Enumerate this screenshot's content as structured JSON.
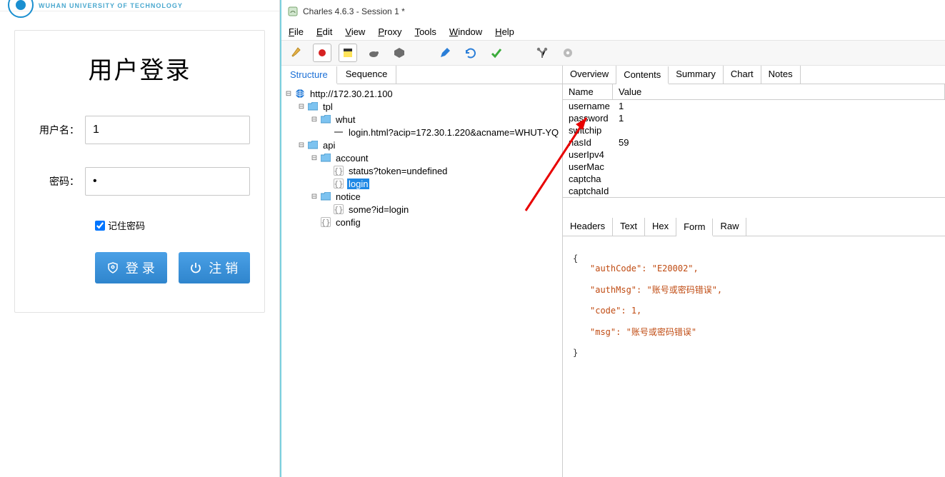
{
  "brand": {
    "text": "WUHAN UNIVERSITY OF TECHNOLOGY"
  },
  "login": {
    "title": "用户登录",
    "username_label": "用户名：",
    "password_label": "密码：",
    "username_value": "1",
    "password_value": "•",
    "remember_label": "记住密码",
    "login_btn": "登 录",
    "logout_btn": "注 销"
  },
  "charles": {
    "title": "Charles 4.6.3 - Session 1 *",
    "menu": {
      "file": "File",
      "edit": "Edit",
      "view": "View",
      "proxy": "Proxy",
      "tools": "Tools",
      "window": "Window",
      "help": "Help"
    },
    "left_tabs": {
      "structure": "Structure",
      "sequence": "Sequence"
    },
    "tree": {
      "root": "http://172.30.21.100",
      "tpl": "tpl",
      "whut": "whut",
      "login_html": "login.html?acip=172.30.1.220&acname=WHUT-YQ",
      "api": "api",
      "account": "account",
      "status": "status?token=undefined",
      "login": "login",
      "notice": "notice",
      "some": "some?id=login",
      "config": "config"
    },
    "right_tabs": {
      "overview": "Overview",
      "contents": "Contents",
      "summary": "Summary",
      "chart": "Chart",
      "notes": "Notes"
    },
    "kv": {
      "head_name": "Name",
      "head_value": "Value",
      "rows": [
        {
          "name": "username",
          "value": "1"
        },
        {
          "name": "password",
          "value": "1"
        },
        {
          "name": "switchip",
          "value": ""
        },
        {
          "name": "nasId",
          "value": "59"
        },
        {
          "name": "userIpv4",
          "value": ""
        },
        {
          "name": "userMac",
          "value": ""
        },
        {
          "name": "captcha",
          "value": ""
        },
        {
          "name": "captchaId",
          "value": ""
        }
      ]
    },
    "lower_tabs": {
      "headers": "Headers",
      "text": "Text",
      "hex": "Hex",
      "form": "Form",
      "raw": "Raw"
    },
    "response": {
      "open": "{",
      "authCode_k": "\"authCode\":",
      "authCode_v": "\"E20002\",",
      "authMsg_k": "\"authMsg\":",
      "authMsg_v": "\"账号或密码错误\",",
      "code_k": "\"code\":",
      "code_v": "1,",
      "msg_k": "\"msg\":",
      "msg_v": "\"账号或密码错误\"",
      "close": "}"
    }
  }
}
